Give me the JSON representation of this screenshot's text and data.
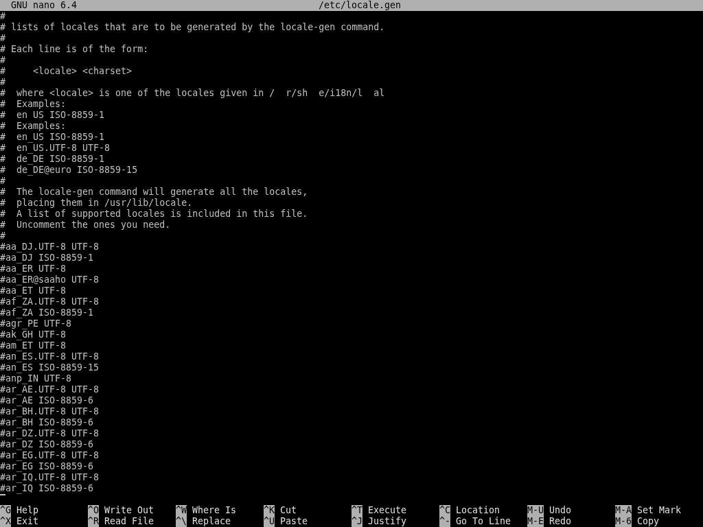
{
  "title_bar": {
    "app": "GNU nano 6.4",
    "file": "/etc/locale.gen"
  },
  "lines": [
    "#",
    "# lists of locales that are to be generated by the locale-gen command.",
    "#",
    "# Each line is of the form:",
    "#",
    "#     <locale> <charset>",
    "#",
    "#  where <locale> is one of the locales given in /  r/sh  e/i18n/l  al",
    "#  Examples:",
    "#  en US ISO-8859-1",
    "#  Examples:",
    "#  en_US ISO-8859-1",
    "#  en_US.UTF-8 UTF-8",
    "#  de_DE ISO-8859-1",
    "#  de_DE@euro ISO-8859-15",
    "#",
    "#  The locale-gen command will generate all the locales,",
    "#  placing them in /usr/lib/locale.",
    "#  A list of supported locales is included in this file.",
    "#  Uncomment the ones you need.",
    "#",
    "#aa_DJ.UTF-8 UTF-8",
    "#aa_DJ ISO-8859-1",
    "#aa_ER UTF-8",
    "#aa_ER@saaho UTF-8",
    "#aa_ET UTF-8",
    "#af_ZA.UTF-8 UTF-8",
    "#af_ZA ISO-8859-1",
    "#agr_PE UTF-8",
    "#ak_GH UTF-8",
    "#am_ET UTF-8",
    "#an_ES.UTF-8 UTF-8",
    "#an_ES ISO-8859-15",
    "#anp_IN UTF-8",
    "#ar_AE.UTF-8 UTF-8",
    "#ar_AE ISO-8859-6",
    "#ar_BH.UTF-8 UTF-8",
    "#ar_BH ISO-8859-6",
    "#ar_DZ.UTF-8 UTF-8",
    "#ar_DZ ISO-8859-6",
    "#ar_EG.UTF-8 UTF-8",
    "#ar_EG ISO-8859-6",
    "#ar_IQ.UTF-8 UTF-8",
    "#ar_IQ ISO-8859-6"
  ],
  "shortcut_rows": [
    [
      {
        "key": "^G",
        "label": "Help"
      },
      {
        "key": "^O",
        "label": "Write Out"
      },
      {
        "key": "^W",
        "label": "Where Is"
      },
      {
        "key": "^K",
        "label": "Cut"
      },
      {
        "key": "^T",
        "label": "Execute"
      },
      {
        "key": "^C",
        "label": "Location"
      },
      {
        "key": "M-U",
        "label": "Undo"
      },
      {
        "key": "M-A",
        "label": "Set Mark"
      }
    ],
    [
      {
        "key": "^X",
        "label": "Exit"
      },
      {
        "key": "^R",
        "label": "Read File"
      },
      {
        "key": "^\\",
        "label": "Replace"
      },
      {
        "key": "^U",
        "label": "Paste"
      },
      {
        "key": "^J",
        "label": "Justify"
      },
      {
        "key": "^-",
        "label": "Go To Line"
      },
      {
        "key": "M-E",
        "label": "Redo"
      },
      {
        "key": "M-6",
        "label": "Copy"
      }
    ]
  ]
}
